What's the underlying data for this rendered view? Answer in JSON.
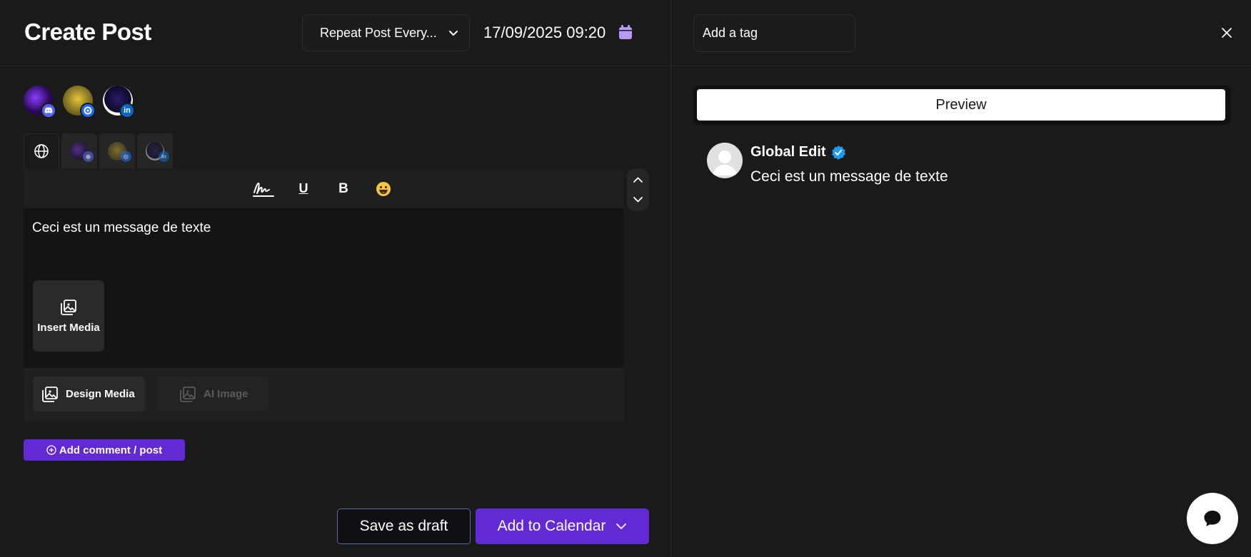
{
  "header": {
    "title": "Create Post",
    "repeat_select": "Repeat Post Every...",
    "datetime": "17/09/2025 09:20"
  },
  "channels": [
    {
      "name": "discord",
      "badge_color": "#5865f2"
    },
    {
      "name": "nostr",
      "badge_color": "#1d6af5"
    },
    {
      "name": "linkedin",
      "badge_color": "#0a66c2"
    }
  ],
  "editor": {
    "text": "Ceci est un message de texte",
    "insert_media_label": "Insert Media",
    "design_media_label": "Design Media",
    "ai_image_label": "AI Image"
  },
  "actions": {
    "add_comment_label": "Add comment / post",
    "save_draft_label": "Save as draft",
    "add_calendar_label": "Add to Calendar"
  },
  "sidebar": {
    "tag_input_value": "Add a tag",
    "preview_label": "Preview",
    "preview_name": "Global Edit",
    "preview_text": "Ceci est un message de texte"
  },
  "colors": {
    "accent": "#612ad5",
    "calendar_icon": "#b69af8",
    "verified": "#1d9bf0"
  }
}
